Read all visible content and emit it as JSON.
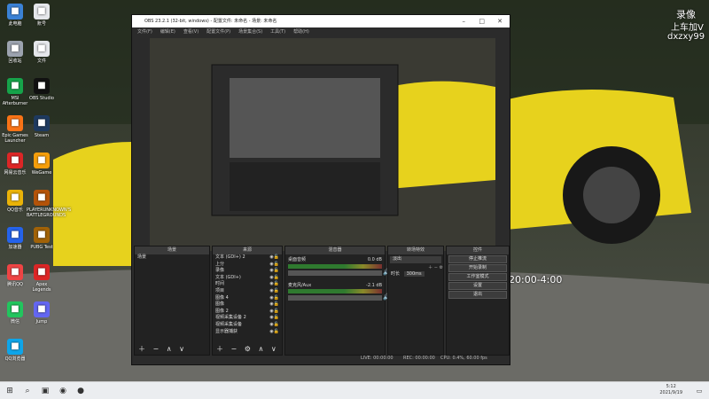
{
  "desktop": {
    "icons": [
      {
        "label": "此电脑",
        "icon": "computer-icon",
        "color": "#3b82d6"
      },
      {
        "label": "回收站",
        "icon": "recycle-bin-icon",
        "color": "#9ca3af"
      },
      {
        "label": "MSI Afterburner",
        "icon": "afterburner-icon",
        "color": "#16a34a"
      },
      {
        "label": "Epic Games Launcher",
        "icon": "epic-icon",
        "color": "#f97316"
      },
      {
        "label": "网易云音乐",
        "icon": "netease-music-icon",
        "color": "#dc2626"
      },
      {
        "label": "QQ音乐",
        "icon": "qq-music-icon",
        "color": "#eab308"
      },
      {
        "label": "加速器",
        "icon": "accelerator-icon",
        "color": "#2563eb"
      },
      {
        "label": "腾讯QQ",
        "icon": "qq-icon",
        "color": "#ef4444"
      },
      {
        "label": "微信",
        "icon": "wechat-icon",
        "color": "#22c55e"
      },
      {
        "label": "QQ浏览器",
        "icon": "qq-browser-icon",
        "color": "#0ea5e9"
      },
      {
        "label": "账号",
        "icon": "file-icon",
        "color": "#e5e7eb"
      },
      {
        "label": "文件",
        "icon": "file-icon",
        "color": "#e5e7eb"
      },
      {
        "label": "OBS Studio",
        "icon": "obs-icon",
        "color": "#111"
      },
      {
        "label": "Steam",
        "icon": "steam-icon",
        "color": "#1e3a5f"
      },
      {
        "label": "WeGame",
        "icon": "wegame-icon",
        "color": "#f59e0b"
      },
      {
        "label": "PLAYERUNKNOWN'S BATTLEGROUNDS",
        "icon": "pubg-icon",
        "color": "#b45309"
      },
      {
        "label": "PUBG Test",
        "icon": "pubg-test-icon",
        "color": "#a16207"
      },
      {
        "label": "Apex Legends",
        "icon": "apex-icon",
        "color": "#dc2626"
      },
      {
        "label": "Jump",
        "icon": "jump-icon",
        "color": "#6366f1"
      }
    ],
    "overlay": {
      "line1": "录像",
      "line2": "上车加V",
      "line3": "dxzxy99",
      "time": "新时间：20:00-4:00"
    }
  },
  "obs": {
    "title": "OBS 23.2.1 (32-bit, windows) - 配置文件: 未命名 - 场景: 未命名",
    "menu": [
      "文件(F)",
      "编辑(E)",
      "查看(V)",
      "配置文件(P)",
      "场景集合(S)",
      "工具(T)",
      "帮助(H)"
    ],
    "docks": {
      "scenes": {
        "title": "场景",
        "items": [
          "场景"
        ]
      },
      "sources": {
        "title": "来源",
        "items": [
          "文本 (GDI+) 2",
          "上分",
          "录像",
          "文本 (GDI+)",
          "时间",
          "项目",
          "图像 4",
          "图像",
          "图像 2",
          "视频采集设备 2",
          "视频采集设备",
          "显示器捕获"
        ]
      },
      "mixer": {
        "title": "混音器",
        "tracks": [
          {
            "name": "桌面音频",
            "db": "0.0 dB"
          },
          {
            "name": "麦克风/Aux",
            "db": "-2.1 dB"
          }
        ]
      },
      "transitions": {
        "title": "转场特效",
        "type": "淡出",
        "duration_label": "时长",
        "duration": "300ms"
      },
      "controls": {
        "title": "控件",
        "buttons": [
          "停止推流",
          "开始录制",
          "工作室模式",
          "设置",
          "退出"
        ]
      }
    },
    "status": {
      "live": "LIVE: 00:00:00",
      "rec": "REC: 00:00:00",
      "cpu": "CPU: 0.4%, 60.00 fps"
    }
  },
  "taskbar": {
    "time": "5:12",
    "date": "2021/9/19"
  }
}
